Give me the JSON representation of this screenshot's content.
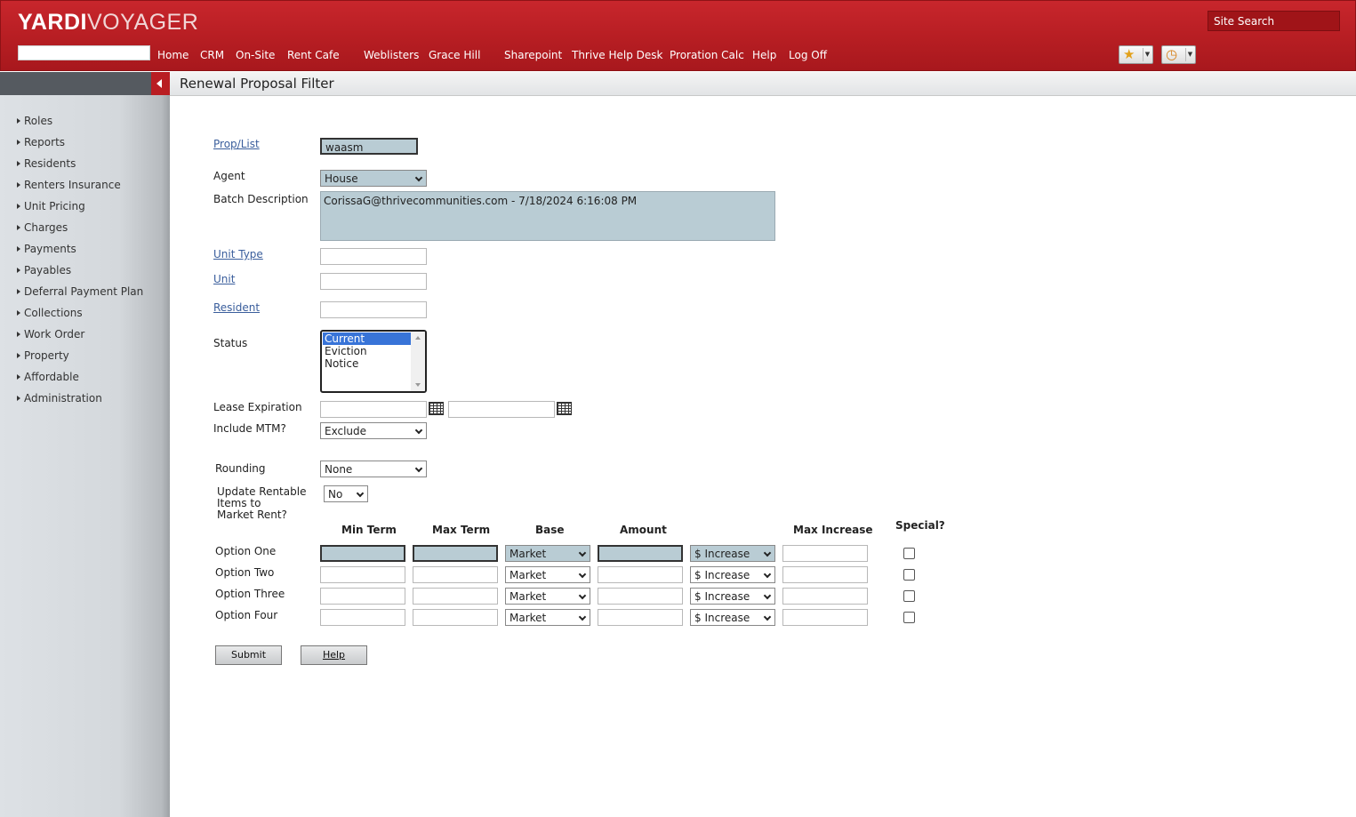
{
  "header": {
    "logo_primary": "YARDI",
    "logo_secondary": "VOYAGER",
    "site_search": "Site Search",
    "nav": [
      "Home",
      "CRM",
      "On-Site",
      "Rent Cafe",
      "Weblisters",
      "Grace Hill",
      "Sharepoint",
      "Thrive Help Desk",
      "Proration Calc",
      "Help",
      "Log Off"
    ],
    "favorites_icon": "star-icon",
    "history_icon": "clock-icon",
    "brand_color": "#c3242a"
  },
  "sidebar": {
    "items": [
      "Roles",
      "Reports",
      "Residents",
      "Renters Insurance",
      "Unit Pricing",
      "Charges",
      "Payments",
      "Payables",
      "Deferral Payment Plan",
      "Collections",
      "Work Order",
      "Property",
      "Affordable",
      "Administration"
    ]
  },
  "page": {
    "title": "Renewal Proposal Filter"
  },
  "form": {
    "prop_list": {
      "label": "Prop/List",
      "value": "waasm"
    },
    "agent": {
      "label": "Agent",
      "value": "House"
    },
    "batch_description": {
      "label": "Batch Description",
      "value": "CorissaG@thrivecommunities.com - 7/18/2024 6:16:08 PM"
    },
    "unit_type": {
      "label": "Unit Type",
      "value": ""
    },
    "unit": {
      "label": "Unit",
      "value": ""
    },
    "resident": {
      "label": "Resident",
      "value": ""
    },
    "status": {
      "label": "Status",
      "options": [
        "Current",
        "Eviction",
        "Notice"
      ],
      "selected": "Current"
    },
    "lease_expiration": {
      "label": "Lease Expiration",
      "from": "",
      "to": ""
    },
    "include_mtm": {
      "label": "Include MTM?",
      "value": "Exclude"
    },
    "rounding": {
      "label": "Rounding",
      "value": "None"
    },
    "update_rentable": {
      "label_lines": [
        "Update Rentable",
        "Items to",
        "Market Rent?"
      ],
      "value": "No"
    },
    "columns": {
      "min_term": "Min Term",
      "max_term": "Max Term",
      "base": "Base",
      "amount": "Amount",
      "max_increase": "Max Increase",
      "special": "Special?"
    },
    "options": [
      {
        "label": "Option One",
        "base": "Market",
        "type": "$ Increase"
      },
      {
        "label": "Option Two",
        "base": "Market",
        "type": "$ Increase"
      },
      {
        "label": "Option Three",
        "base": "Market",
        "type": "$ Increase"
      },
      {
        "label": "Option Four",
        "base": "Market",
        "type": "$ Increase"
      }
    ],
    "submit": "Submit",
    "help": "Help"
  }
}
